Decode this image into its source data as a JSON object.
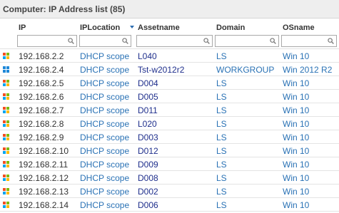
{
  "title": "Computer: IP Address list (85)",
  "columns": [
    {
      "key": "ip",
      "label": "IP"
    },
    {
      "key": "location",
      "label": "IPLocation"
    },
    {
      "key": "asset",
      "label": "Assetname"
    },
    {
      "key": "domain",
      "label": "Domain"
    },
    {
      "key": "os",
      "label": "OSname"
    }
  ],
  "sort": {
    "column": "Assetname",
    "direction": "descending"
  },
  "filters": {
    "ip": "",
    "location": "",
    "asset": "",
    "domain": "",
    "os": ""
  },
  "rows": [
    {
      "icon": "windows-logo-icon",
      "ip": "192.168.2.2",
      "location": "DHCP scope",
      "asset": "L040",
      "domain": "LS",
      "os": "Win 10"
    },
    {
      "icon": "windows-server-icon",
      "ip": "192.168.2.4",
      "location": "DHCP scope",
      "asset": "Tst-w2012r2",
      "domain": "WORKGROUP",
      "os": "Win 2012 R2"
    },
    {
      "icon": "windows-logo-icon",
      "ip": "192.168.2.5",
      "location": "DHCP scope",
      "asset": "D004",
      "domain": "LS",
      "os": "Win 10"
    },
    {
      "icon": "windows-logo-icon",
      "ip": "192.168.2.6",
      "location": "DHCP scope",
      "asset": "D005",
      "domain": "LS",
      "os": "Win 10"
    },
    {
      "icon": "windows-logo-icon",
      "ip": "192.168.2.7",
      "location": "DHCP scope",
      "asset": "D011",
      "domain": "LS",
      "os": "Win 10"
    },
    {
      "icon": "windows-logo-icon",
      "ip": "192.168.2.8",
      "location": "DHCP scope",
      "asset": "L020",
      "domain": "LS",
      "os": "Win 10"
    },
    {
      "icon": "windows-logo-icon",
      "ip": "192.168.2.9",
      "location": "DHCP scope",
      "asset": "D003",
      "domain": "LS",
      "os": "Win 10"
    },
    {
      "icon": "windows-logo-icon",
      "ip": "192.168.2.10",
      "location": "DHCP scope",
      "asset": "D012",
      "domain": "LS",
      "os": "Win 10"
    },
    {
      "icon": "windows-logo-icon",
      "ip": "192.168.2.11",
      "location": "DHCP scope",
      "asset": "D009",
      "domain": "LS",
      "os": "Win 10"
    },
    {
      "icon": "windows-logo-icon",
      "ip": "192.168.2.12",
      "location": "DHCP scope",
      "asset": "D008",
      "domain": "LS",
      "os": "Win 10"
    },
    {
      "icon": "windows-logo-icon",
      "ip": "192.168.2.13",
      "location": "DHCP scope",
      "asset": "D002",
      "domain": "LS",
      "os": "Win 10"
    },
    {
      "icon": "windows-logo-icon",
      "ip": "192.168.2.14",
      "location": "DHCP scope",
      "asset": "D006",
      "domain": "LS",
      "os": "Win 10"
    }
  ]
}
